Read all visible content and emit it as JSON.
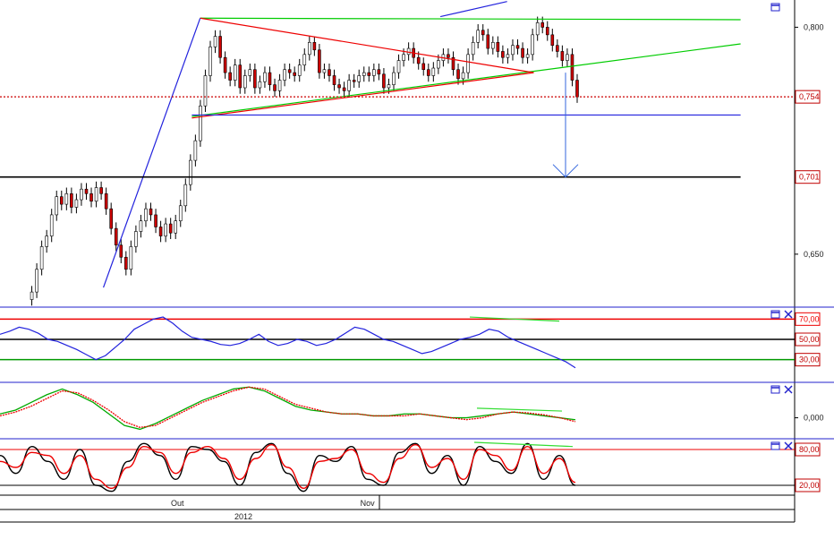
{
  "chart_data": {
    "type": "candlestick",
    "instrument_panels": 4,
    "price_panel": {
      "y_range": [
        0.615,
        0.818
      ],
      "y_ticks": [
        {
          "value": 0.8,
          "label": "0,800"
        },
        {
          "value": 0.65,
          "label": "0,650"
        }
      ],
      "tags": [
        {
          "value": 0.754,
          "label": "0,754",
          "color": "#c00000"
        },
        {
          "value": 0.701,
          "label": "0,701",
          "color": "#c00000"
        }
      ],
      "series_close": [
        0.62,
        0.625,
        0.64,
        0.655,
        0.662,
        0.676,
        0.688,
        0.683,
        0.69,
        0.681,
        0.686,
        0.693,
        0.69,
        0.685,
        0.694,
        0.69,
        0.68,
        0.667,
        0.656,
        0.648,
        0.64,
        0.655,
        0.665,
        0.672,
        0.68,
        0.676,
        0.668,
        0.662,
        0.67,
        0.664,
        0.672,
        0.682,
        0.696,
        0.712,
        0.725,
        0.748,
        0.768,
        0.787,
        0.794,
        0.78,
        0.77,
        0.765,
        0.775,
        0.76,
        0.768,
        0.772,
        0.76,
        0.764,
        0.77,
        0.762,
        0.758,
        0.765,
        0.772,
        0.77,
        0.768,
        0.775,
        0.782,
        0.79,
        0.785,
        0.77,
        0.772,
        0.768,
        0.762,
        0.76,
        0.758,
        0.765,
        0.764,
        0.768,
        0.77,
        0.768,
        0.772,
        0.769,
        0.76,
        0.762,
        0.77,
        0.778,
        0.782,
        0.786,
        0.78,
        0.776,
        0.772,
        0.768,
        0.773,
        0.778,
        0.782,
        0.78,
        0.772,
        0.766,
        0.77,
        0.782,
        0.79,
        0.798,
        0.795,
        0.786,
        0.79,
        0.784,
        0.78,
        0.782,
        0.788,
        0.786,
        0.78,
        0.782,
        0.795,
        0.803,
        0.8,
        0.795,
        0.788,
        0.784,
        0.778,
        0.782,
        0.765,
        0.754
      ],
      "lines": [
        {
          "name": "resistance-green",
          "color": "#00cc00",
          "from": [
            0.24,
            0.806
          ],
          "to": [
            0.888,
            0.805
          ]
        },
        {
          "name": "rising-green",
          "color": "#00cc00",
          "from": [
            0.23,
            0.741
          ],
          "to": [
            0.888,
            0.789
          ]
        },
        {
          "name": "descending-red",
          "color": "#ee0000",
          "from": [
            0.24,
            0.806
          ],
          "to": [
            0.64,
            0.77
          ]
        },
        {
          "name": "ascending-red",
          "color": "#ee0000",
          "from": [
            0.23,
            0.74
          ],
          "to": [
            0.64,
            0.77
          ]
        },
        {
          "name": "blue-impulse",
          "color": "#2222dd",
          "from": [
            0.124,
            0.628
          ],
          "to": [
            0.24,
            0.806
          ]
        },
        {
          "name": "blue-top",
          "color": "#2222dd",
          "from": [
            0.528,
            0.807
          ],
          "to": [
            0.608,
            0.817
          ]
        },
        {
          "name": "blue-support",
          "color": "#2222dd",
          "from": [
            0.23,
            0.742
          ],
          "to": [
            0.888,
            0.742
          ]
        },
        {
          "name": "black-level",
          "color": "#000000",
          "from": [
            0.0,
            0.701
          ],
          "to": [
            0.888,
            0.701
          ]
        }
      ],
      "dotted_level": 0.754
    },
    "rsi_panel": {
      "levels": [
        {
          "value": 70,
          "label": "70,00",
          "color": "#ee0000"
        },
        {
          "value": 50,
          "label": "50,00",
          "color": "#000000"
        },
        {
          "value": 30,
          "label": "30,00",
          "color": "#009900"
        }
      ],
      "series": [
        55,
        58,
        62,
        60,
        56,
        50,
        48,
        44,
        40,
        35,
        30,
        34,
        42,
        50,
        60,
        65,
        70,
        72,
        66,
        58,
        52,
        50,
        48,
        45,
        44,
        46,
        50,
        55,
        48,
        44,
        46,
        50,
        48,
        44,
        46,
        50,
        56,
        62,
        60,
        55,
        50,
        48,
        44,
        40,
        36,
        38,
        42,
        46,
        50,
        52,
        55,
        60,
        58,
        52,
        48,
        44,
        40,
        36,
        32,
        28,
        22
      ]
    },
    "macd_panel": {
      "level": {
        "value": 0,
        "label": "0,000"
      },
      "series": [
        {
          "color": "#00aa00",
          "values": [
            0.2,
            0.4,
            0.8,
            1.2,
            1.5,
            1.2,
            0.8,
            0.2,
            -0.4,
            -0.6,
            -0.3,
            0.1,
            0.5,
            0.9,
            1.2,
            1.5,
            1.6,
            1.4,
            1.0,
            0.6,
            0.4,
            0.3,
            0.2,
            0.2,
            0.1,
            0.1,
            0.2,
            0.2,
            0.1,
            0.0,
            0.0,
            0.1,
            0.2,
            0.3,
            0.2,
            0.1,
            0.0,
            -0.1
          ]
        },
        {
          "color": "#ee0000",
          "values": [
            0.1,
            0.3,
            0.6,
            1.0,
            1.4,
            1.3,
            0.9,
            0.4,
            -0.2,
            -0.5,
            -0.4,
            0.0,
            0.4,
            0.8,
            1.1,
            1.4,
            1.6,
            1.5,
            1.1,
            0.7,
            0.5,
            0.3,
            0.2,
            0.2,
            0.1,
            0.1,
            0.1,
            0.2,
            0.1,
            0.0,
            -0.1,
            0.0,
            0.2,
            0.3,
            0.25,
            0.15,
            0.0,
            -0.2
          ]
        }
      ]
    },
    "stoch_panel": {
      "levels": [
        {
          "value": 80,
          "label": "80,00",
          "color": "#ee0000"
        },
        {
          "value": 20,
          "label": "20,00",
          "color": "#000000"
        }
      ],
      "series": [
        {
          "color": "#000000",
          "values": [
            70,
            40,
            85,
            60,
            30,
            80,
            20,
            10,
            60,
            90,
            70,
            30,
            85,
            80,
            60,
            20,
            75,
            90,
            40,
            10,
            70,
            60,
            85,
            30,
            20,
            75,
            90,
            40,
            70,
            20,
            85,
            60,
            40,
            90,
            30,
            70,
            20
          ]
        },
        {
          "color": "#ee0000",
          "values": [
            60,
            50,
            75,
            70,
            40,
            70,
            30,
            15,
            50,
            85,
            75,
            40,
            75,
            85,
            65,
            30,
            65,
            88,
            50,
            15,
            60,
            65,
            80,
            40,
            25,
            65,
            88,
            50,
            65,
            30,
            80,
            70,
            45,
            85,
            40,
            65,
            25
          ]
        }
      ]
    },
    "x_axis": {
      "ticks": [
        {
          "position": 0.205,
          "label": "Out"
        },
        {
          "position": 0.432,
          "label": "Nov"
        }
      ],
      "year_label": "2012"
    }
  }
}
